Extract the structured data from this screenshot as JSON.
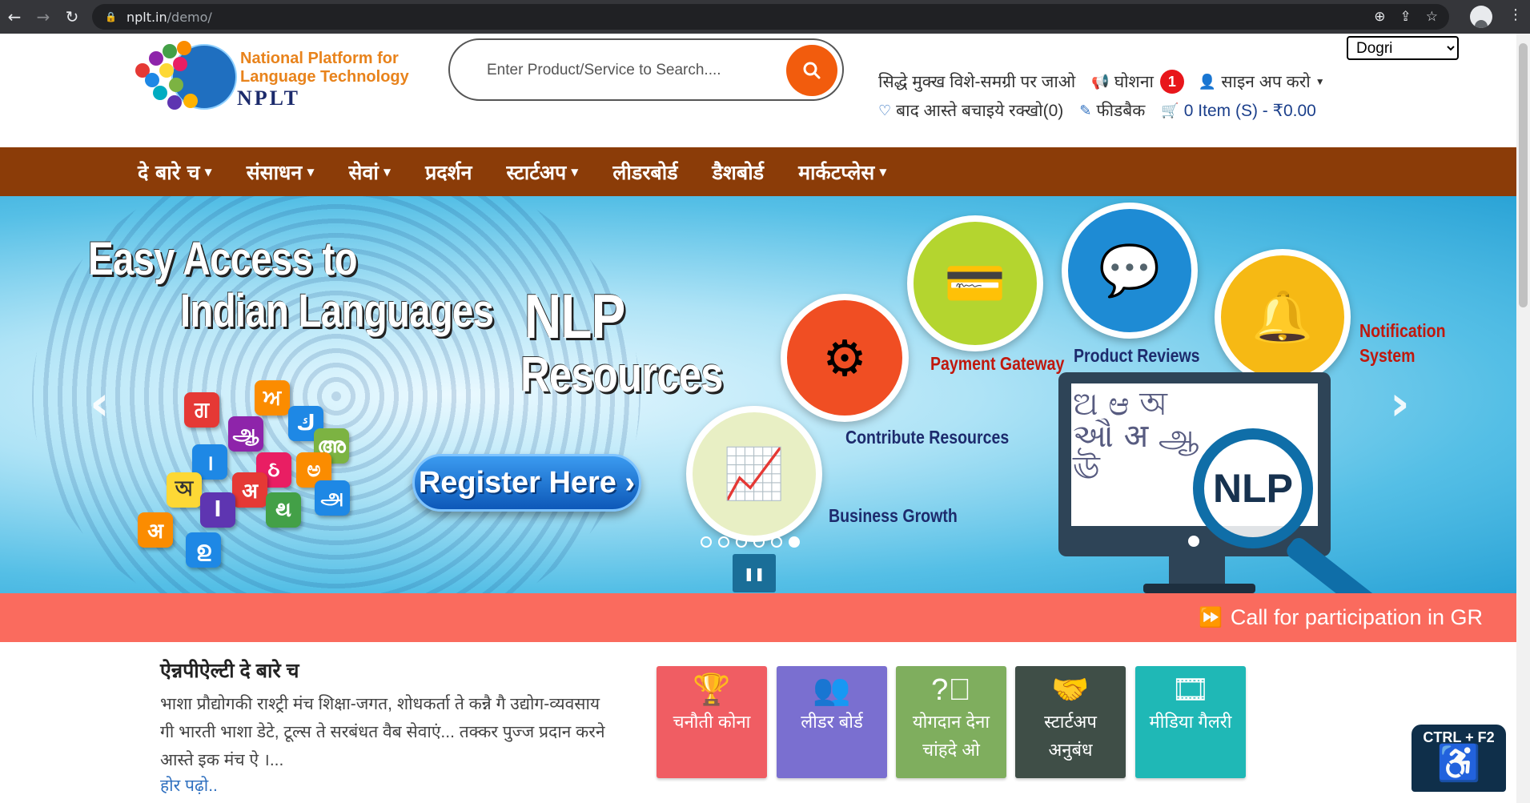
{
  "browser": {
    "url_host": "nplt.in",
    "url_path": "/demo/"
  },
  "logo": {
    "line1": "National Platform for",
    "line2": "Language Technology",
    "line3": "NPLT"
  },
  "search": {
    "placeholder": "Enter Product/Service to Search...."
  },
  "language": {
    "selected": "Dogri"
  },
  "toplinks": {
    "skip_to_main": "सिद्धे मुक्ख विशे-समग्री पर जाओ",
    "announcement": "घोशना",
    "announcement_count": "1",
    "signup": "साइन अप करो",
    "wishlist": "बाद आस्ते बचाइये रक्खो(0)",
    "feedback": "फीडबैक",
    "cart": "0 Item (S) - ₹0.00"
  },
  "navbar": {
    "items": [
      {
        "label": "दे बारे च",
        "dropdown": true
      },
      {
        "label": "संसाधन",
        "dropdown": true
      },
      {
        "label": "सेवां",
        "dropdown": true
      },
      {
        "label": "प्रदर्शन",
        "dropdown": false
      },
      {
        "label": "स्टार्टअप",
        "dropdown": true
      },
      {
        "label": "लीडरबोर्ड",
        "dropdown": false
      },
      {
        "label": "डैशबोर्ड",
        "dropdown": false
      },
      {
        "label": "मार्कटप्लेस",
        "dropdown": true
      }
    ]
  },
  "banner": {
    "headline_1": "Easy Access to",
    "headline_2": "Indian Languages",
    "headline_3": "NLP",
    "headline_4": "Resources",
    "register_label": "Register Here ›",
    "labels": {
      "payment_gateway": "Payment Gateway",
      "product_reviews": "Product Reviews",
      "notification_1": "Notification",
      "notification_2": "System",
      "contribute": "Contribute Resources",
      "business_growth": "Business Growth",
      "nlp": "NLP"
    },
    "slide_count": 6,
    "active_slide": 6
  },
  "marquee": {
    "text": "Call for participation in GR"
  },
  "about": {
    "title": "ऐन्नपीऐल्टी दे बारे च",
    "text": "भाशा प्रौद्योगकी राश्ट्री मंच शिक्षा-जगत, शोधकर्ता ते कन्नै गै उद्योग-व्यवसाय गी भारती भाशा डेटे, टूल्स ते सरबंधत वैब सेवाएं... तक्कर पुज्ज प्रदान करने आस्ते इक मंच ऐ ।...",
    "read_more": "होर पढ़ो.."
  },
  "cards": [
    {
      "line1": "चनौती कोना",
      "line2": "",
      "color": "#f05d63",
      "icon": "trophy-icon"
    },
    {
      "line1": "लीडर बोर्ड",
      "line2": "",
      "color": "#7a6fd0",
      "icon": "users-icon"
    },
    {
      "line1": "योगदान देना",
      "line2": "चांहदे ओ",
      "color": "#7fae5e",
      "icon": "question-circle-icon"
    },
    {
      "line1": "स्टार्टअप",
      "line2": "अनुबंध",
      "color": "#3f4e47",
      "icon": "handshake-icon"
    },
    {
      "line1": "मीडिया गैलरी",
      "line2": "",
      "color": "#1fb8b6",
      "icon": "video-file-icon"
    }
  ],
  "accessibility": {
    "shortcut": "CTRL + F2"
  },
  "colors": {
    "navbar": "#8b3c08",
    "marquee": "#fa6b5e",
    "search_button": "#f25c0d",
    "badge": "#e8161b"
  }
}
